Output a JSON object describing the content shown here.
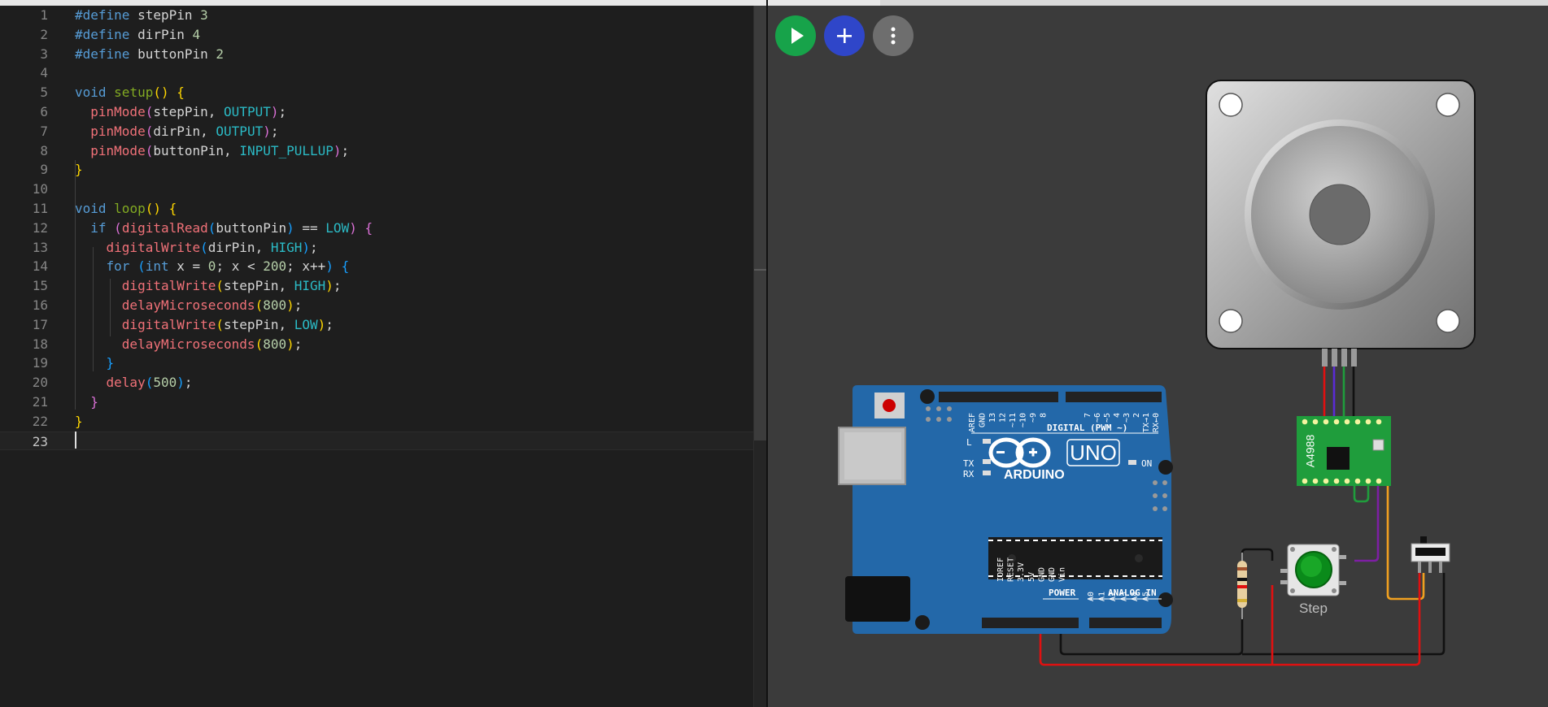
{
  "editor": {
    "lines": [
      {
        "n": "1",
        "html": "<span class='k'>#define</span> stepPin <span class='nm'>3</span>"
      },
      {
        "n": "2",
        "html": "<span class='k'>#define</span> dirPin <span class='nm'>4</span>"
      },
      {
        "n": "3",
        "html": "<span class='k'>#define</span> buttonPin <span class='nm'>2</span>"
      },
      {
        "n": "4",
        "html": ""
      },
      {
        "n": "5",
        "html": "<span class='k'>void</span> <span class='df'>setup</span><span class='b1'>()</span> <span class='b1'>{</span>"
      },
      {
        "n": "6",
        "html": "  <span class='fn'>pinMode</span><span class='b2'>(</span>stepPin, <span class='cs'>OUTPUT</span><span class='b2'>)</span>;"
      },
      {
        "n": "7",
        "html": "  <span class='fn'>pinMode</span><span class='b2'>(</span>dirPin, <span class='cs'>OUTPUT</span><span class='b2'>)</span>;"
      },
      {
        "n": "8",
        "html": "  <span class='fn'>pinMode</span><span class='b2'>(</span>buttonPin, <span class='cs'>INPUT_PULLUP</span><span class='b2'>)</span>;"
      },
      {
        "n": "9",
        "html": "<span class='b1'>}</span>"
      },
      {
        "n": "10",
        "html": ""
      },
      {
        "n": "11",
        "html": "<span class='k'>void</span> <span class='df'>loop</span><span class='b1'>()</span> <span class='b1'>{</span>"
      },
      {
        "n": "12",
        "html": "  <span class='k'>if</span> <span class='b2'>(</span><span class='fn'>digitalRead</span><span class='b3'>(</span>buttonPin<span class='b3'>)</span> == <span class='cs'>LOW</span><span class='b2'>)</span> <span class='b2'>{</span>"
      },
      {
        "n": "13",
        "html": "    <span class='fn'>digitalWrite</span><span class='b3'>(</span>dirPin, <span class='cs'>HIGH</span><span class='b3'>)</span>;"
      },
      {
        "n": "14",
        "html": "    <span class='k'>for</span> <span class='b3'>(</span><span class='k'>int</span> x = <span class='nm'>0</span>; x &lt; <span class='nm'>200</span>; x++<span class='b3'>)</span> <span class='b3'>{</span>"
      },
      {
        "n": "15",
        "html": "      <span class='fn'>digitalWrite</span><span class='b1'>(</span>stepPin, <span class='cs'>HIGH</span><span class='b1'>)</span>;"
      },
      {
        "n": "16",
        "html": "      <span class='fn'>delayMicroseconds</span><span class='b1'>(</span><span class='nm'>800</span><span class='b1'>)</span>;"
      },
      {
        "n": "17",
        "html": "      <span class='fn'>digitalWrite</span><span class='b1'>(</span>stepPin, <span class='cs'>LOW</span><span class='b1'>)</span>;"
      },
      {
        "n": "18",
        "html": "      <span class='fn'>delayMicroseconds</span><span class='b1'>(</span><span class='nm'>800</span><span class='b1'>)</span>;"
      },
      {
        "n": "19",
        "html": "    <span class='b3'>}</span>"
      },
      {
        "n": "20",
        "html": "    <span class='fn'>delay</span><span class='b3'>(</span><span class='nm'>500</span><span class='b3'>)</span>;"
      },
      {
        "n": "21",
        "html": "  <span class='b2'>}</span>"
      },
      {
        "n": "22",
        "html": "<span class='b1'>}</span>"
      },
      {
        "n": "23",
        "html": ""
      }
    ],
    "active_line": "23"
  },
  "toolbar": {
    "run_icon": "play-icon",
    "add_icon": "plus-icon",
    "more_icon": "more-vertical-icon"
  },
  "board": {
    "logo_text": "ARDUINO",
    "model_text": "UNO",
    "on_label": "ON",
    "l_label": "L",
    "tx_label": "TX",
    "rx_label": "RX",
    "digital_label": "DIGITAL (PWM ~)",
    "power_label": "POWER",
    "analog_label": "ANALOG IN",
    "digital_pins": [
      "AREF",
      "GND",
      "13",
      "12",
      "~11",
      "~10",
      "~9",
      "8",
      "7",
      "~6",
      "~5",
      "4",
      "~3",
      "2",
      "TX→1",
      "RX←0"
    ],
    "power_pins": [
      "IOREF",
      "RESET",
      "3.3V",
      "5V",
      "GND",
      "GND",
      "Vin"
    ],
    "analog_pins": [
      "A0",
      "A1",
      "A2",
      "A3",
      "A4",
      "A5"
    ]
  },
  "driver": {
    "label": "A4988"
  },
  "button": {
    "label": "Step"
  },
  "colors": {
    "board": "#2368a9",
    "driver": "#1f9d3c",
    "wire_red": "#e01010",
    "wire_black": "#111111",
    "wire_orange": "#f0a020",
    "wire_purple": "#7d1fa3",
    "wire_green": "#1f9d3c",
    "wire_blue": "#5a2bd4"
  }
}
